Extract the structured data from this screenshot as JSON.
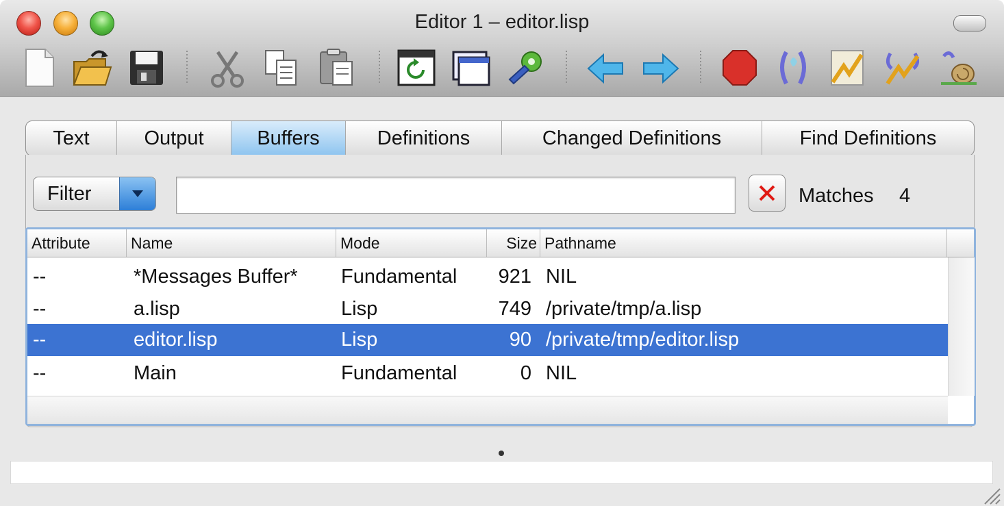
{
  "window": {
    "title": "Editor 1 – editor.lisp"
  },
  "toolbar": {
    "icons": [
      "new-file-icon",
      "open-folder-icon",
      "save-icon",
      "cut-icon",
      "copy-icon",
      "paste-icon",
      "refresh-window-icon",
      "window-icon",
      "gear-wrench-icon",
      "back-arrow-icon",
      "forward-arrow-icon",
      "stop-icon",
      "step-icon",
      "trace-icon",
      "untrace-icon",
      "snail-icon"
    ]
  },
  "tabs": [
    {
      "label": "Text",
      "active": false
    },
    {
      "label": "Output",
      "active": false
    },
    {
      "label": "Buffers",
      "active": true
    },
    {
      "label": "Definitions",
      "active": false
    },
    {
      "label": "Changed Definitions",
      "active": false
    },
    {
      "label": "Find Definitions",
      "active": false
    }
  ],
  "filter": {
    "button_label": "Filter",
    "input_value": "",
    "matches_label": "Matches",
    "matches_count": "4"
  },
  "table": {
    "columns": [
      "Attribute",
      "Name",
      "Mode",
      "Size",
      "Pathname"
    ],
    "rows": [
      {
        "attribute": "--",
        "name": "*Messages Buffer*",
        "mode": "Fundamental",
        "size": "921",
        "pathname": "NIL",
        "selected": false
      },
      {
        "attribute": "--",
        "name": "a.lisp",
        "mode": "Lisp",
        "size": "749",
        "pathname": "/private/tmp/a.lisp",
        "selected": false
      },
      {
        "attribute": "--",
        "name": "editor.lisp",
        "mode": "Lisp",
        "size": "90",
        "pathname": "/private/tmp/editor.lisp",
        "selected": true
      },
      {
        "attribute": "--",
        "name": "Main",
        "mode": "Fundamental",
        "size": "0",
        "pathname": "NIL",
        "selected": false
      }
    ]
  },
  "echo_area": {
    "text": ""
  },
  "colors": {
    "selection": "#3c73d2",
    "active_tab": "#8ec4ef"
  }
}
